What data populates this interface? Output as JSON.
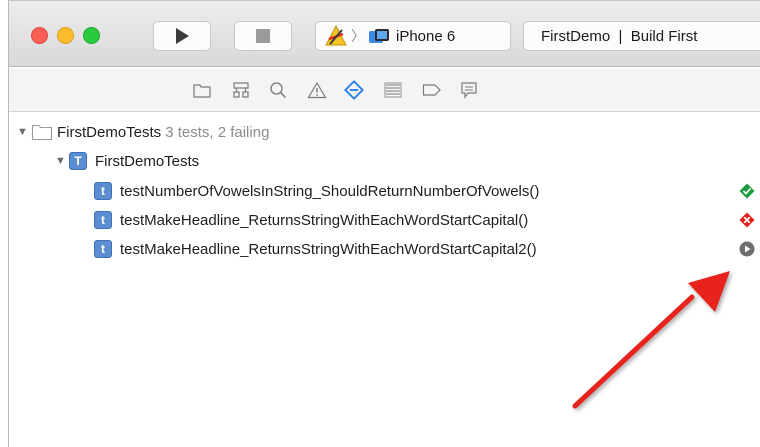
{
  "toolbar": {
    "scheme_device": "iPhone 6",
    "activity_text": "FirstDemo  |  Build First"
  },
  "navigator": {
    "icons": [
      "folder-icon",
      "symbol-icon",
      "search-icon",
      "warning-icon",
      "test-icon",
      "debug-icon",
      "breakpoint-icon",
      "log-icon"
    ],
    "selected": "test-icon"
  },
  "tests": {
    "project": {
      "name": "FirstDemoTests",
      "summary": "3 tests, 2 failing"
    },
    "target": {
      "badge": "T",
      "name": "FirstDemoTests"
    },
    "cases": [
      {
        "badge": "t",
        "name": "testNumberOfVowelsInString_ShouldReturnNumberOfVowels()",
        "status": "passed"
      },
      {
        "badge": "t",
        "name": "testMakeHeadline_ReturnsStringWithEachWordStartCapital()",
        "status": "failed"
      },
      {
        "badge": "t",
        "name": "testMakeHeadline_ReturnsStringWithEachWordStartCapital2()",
        "status": "run"
      }
    ]
  },
  "colors": {
    "passed": "#1a9b3a",
    "failed": "#e0201b",
    "run": "#6e6e6e",
    "arrow": "#e8221c",
    "selected_tab": "#1f7cf5"
  }
}
